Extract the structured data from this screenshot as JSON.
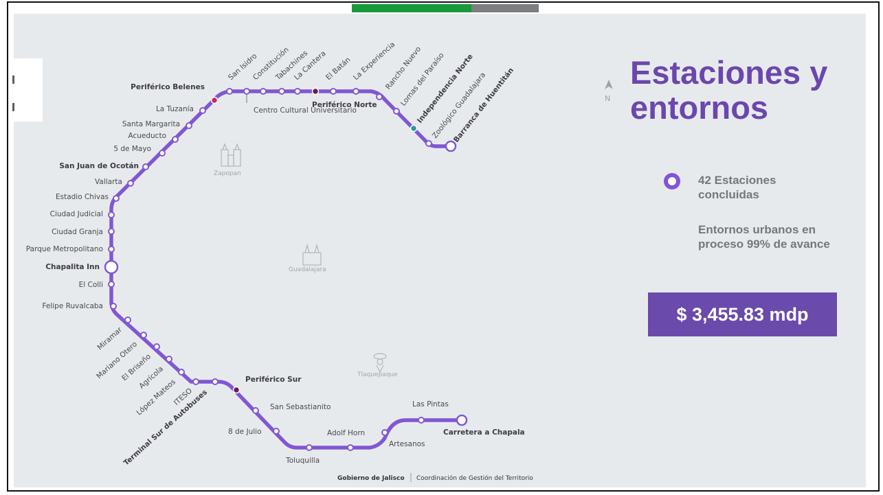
{
  "panel": {
    "title": "Estaciones y entornos",
    "stations_completed": "42 Estaciones concluidas",
    "progress_text": "Entornos urbanos en proceso 99% de avance",
    "budget": "$ 3,455.83 mdp"
  },
  "map": {
    "line_color": "#8157d4",
    "north_label": "N",
    "cities": [
      "Zapopan",
      "Guadalajara",
      "Tlaquepaque"
    ],
    "stations": [
      "Periférico Belenes",
      "La Tuzanía",
      "Santa Margarita",
      "Acueducto",
      "5 de Mayo",
      "San Juan de Ocotán",
      "Vallarta",
      "Estadio Chivas",
      "Ciudad Judicial",
      "Ciudad Granja",
      "Parque Metropolitano",
      "Chapalita Inn",
      "El Colli",
      "Felipe Ruvalcaba",
      "Miramar",
      "Mariano Otero",
      "El Briseño",
      "Agrícola",
      "López Mateos",
      "ITESO",
      "Terminal Sur de Autobuses",
      "Periférico Sur",
      "San Sebastianito",
      "8 de Julio",
      "Toluquilla",
      "Adolf Horn",
      "Artesanos",
      "Las Pintas",
      "Carretera a Chapala",
      "San Isidro",
      "Constitución",
      "Tabachines",
      "La Cantera",
      "El Batán",
      "La Experiencia",
      "Rancho Nuevo",
      "Lomas del Paraíso",
      "Independencia Norte",
      "Zoológico Guadalajara",
      "Barranca de Huentitán",
      "Centro Cultural Universitario",
      "Periférico Norte"
    ],
    "footer": {
      "org": "Gobierno de Jalisco",
      "dept": "Coordinación de Gestión del Territorio"
    }
  }
}
